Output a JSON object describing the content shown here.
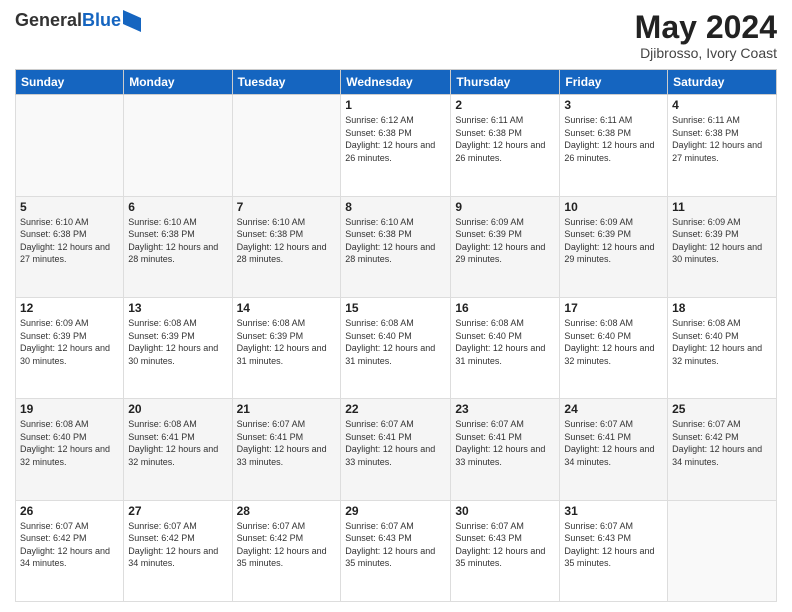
{
  "header": {
    "logo_line1": "General",
    "logo_line2": "Blue",
    "title": "May 2024",
    "location": "Djibrosso, Ivory Coast"
  },
  "weekdays": [
    "Sunday",
    "Monday",
    "Tuesday",
    "Wednesday",
    "Thursday",
    "Friday",
    "Saturday"
  ],
  "weeks": [
    [
      {
        "day": "",
        "sunrise": "",
        "sunset": "",
        "daylight": ""
      },
      {
        "day": "",
        "sunrise": "",
        "sunset": "",
        "daylight": ""
      },
      {
        "day": "",
        "sunrise": "",
        "sunset": "",
        "daylight": ""
      },
      {
        "day": "1",
        "sunrise": "Sunrise: 6:12 AM",
        "sunset": "Sunset: 6:38 PM",
        "daylight": "Daylight: 12 hours and 26 minutes."
      },
      {
        "day": "2",
        "sunrise": "Sunrise: 6:11 AM",
        "sunset": "Sunset: 6:38 PM",
        "daylight": "Daylight: 12 hours and 26 minutes."
      },
      {
        "day": "3",
        "sunrise": "Sunrise: 6:11 AM",
        "sunset": "Sunset: 6:38 PM",
        "daylight": "Daylight: 12 hours and 26 minutes."
      },
      {
        "day": "4",
        "sunrise": "Sunrise: 6:11 AM",
        "sunset": "Sunset: 6:38 PM",
        "daylight": "Daylight: 12 hours and 27 minutes."
      }
    ],
    [
      {
        "day": "5",
        "sunrise": "Sunrise: 6:10 AM",
        "sunset": "Sunset: 6:38 PM",
        "daylight": "Daylight: 12 hours and 27 minutes."
      },
      {
        "day": "6",
        "sunrise": "Sunrise: 6:10 AM",
        "sunset": "Sunset: 6:38 PM",
        "daylight": "Daylight: 12 hours and 28 minutes."
      },
      {
        "day": "7",
        "sunrise": "Sunrise: 6:10 AM",
        "sunset": "Sunset: 6:38 PM",
        "daylight": "Daylight: 12 hours and 28 minutes."
      },
      {
        "day": "8",
        "sunrise": "Sunrise: 6:10 AM",
        "sunset": "Sunset: 6:38 PM",
        "daylight": "Daylight: 12 hours and 28 minutes."
      },
      {
        "day": "9",
        "sunrise": "Sunrise: 6:09 AM",
        "sunset": "Sunset: 6:39 PM",
        "daylight": "Daylight: 12 hours and 29 minutes."
      },
      {
        "day": "10",
        "sunrise": "Sunrise: 6:09 AM",
        "sunset": "Sunset: 6:39 PM",
        "daylight": "Daylight: 12 hours and 29 minutes."
      },
      {
        "day": "11",
        "sunrise": "Sunrise: 6:09 AM",
        "sunset": "Sunset: 6:39 PM",
        "daylight": "Daylight: 12 hours and 30 minutes."
      }
    ],
    [
      {
        "day": "12",
        "sunrise": "Sunrise: 6:09 AM",
        "sunset": "Sunset: 6:39 PM",
        "daylight": "Daylight: 12 hours and 30 minutes."
      },
      {
        "day": "13",
        "sunrise": "Sunrise: 6:08 AM",
        "sunset": "Sunset: 6:39 PM",
        "daylight": "Daylight: 12 hours and 30 minutes."
      },
      {
        "day": "14",
        "sunrise": "Sunrise: 6:08 AM",
        "sunset": "Sunset: 6:39 PM",
        "daylight": "Daylight: 12 hours and 31 minutes."
      },
      {
        "day": "15",
        "sunrise": "Sunrise: 6:08 AM",
        "sunset": "Sunset: 6:40 PM",
        "daylight": "Daylight: 12 hours and 31 minutes."
      },
      {
        "day": "16",
        "sunrise": "Sunrise: 6:08 AM",
        "sunset": "Sunset: 6:40 PM",
        "daylight": "Daylight: 12 hours and 31 minutes."
      },
      {
        "day": "17",
        "sunrise": "Sunrise: 6:08 AM",
        "sunset": "Sunset: 6:40 PM",
        "daylight": "Daylight: 12 hours and 32 minutes."
      },
      {
        "day": "18",
        "sunrise": "Sunrise: 6:08 AM",
        "sunset": "Sunset: 6:40 PM",
        "daylight": "Daylight: 12 hours and 32 minutes."
      }
    ],
    [
      {
        "day": "19",
        "sunrise": "Sunrise: 6:08 AM",
        "sunset": "Sunset: 6:40 PM",
        "daylight": "Daylight: 12 hours and 32 minutes."
      },
      {
        "day": "20",
        "sunrise": "Sunrise: 6:08 AM",
        "sunset": "Sunset: 6:41 PM",
        "daylight": "Daylight: 12 hours and 32 minutes."
      },
      {
        "day": "21",
        "sunrise": "Sunrise: 6:07 AM",
        "sunset": "Sunset: 6:41 PM",
        "daylight": "Daylight: 12 hours and 33 minutes."
      },
      {
        "day": "22",
        "sunrise": "Sunrise: 6:07 AM",
        "sunset": "Sunset: 6:41 PM",
        "daylight": "Daylight: 12 hours and 33 minutes."
      },
      {
        "day": "23",
        "sunrise": "Sunrise: 6:07 AM",
        "sunset": "Sunset: 6:41 PM",
        "daylight": "Daylight: 12 hours and 33 minutes."
      },
      {
        "day": "24",
        "sunrise": "Sunrise: 6:07 AM",
        "sunset": "Sunset: 6:41 PM",
        "daylight": "Daylight: 12 hours and 34 minutes."
      },
      {
        "day": "25",
        "sunrise": "Sunrise: 6:07 AM",
        "sunset": "Sunset: 6:42 PM",
        "daylight": "Daylight: 12 hours and 34 minutes."
      }
    ],
    [
      {
        "day": "26",
        "sunrise": "Sunrise: 6:07 AM",
        "sunset": "Sunset: 6:42 PM",
        "daylight": "Daylight: 12 hours and 34 minutes."
      },
      {
        "day": "27",
        "sunrise": "Sunrise: 6:07 AM",
        "sunset": "Sunset: 6:42 PM",
        "daylight": "Daylight: 12 hours and 34 minutes."
      },
      {
        "day": "28",
        "sunrise": "Sunrise: 6:07 AM",
        "sunset": "Sunset: 6:42 PM",
        "daylight": "Daylight: 12 hours and 35 minutes."
      },
      {
        "day": "29",
        "sunrise": "Sunrise: 6:07 AM",
        "sunset": "Sunset: 6:43 PM",
        "daylight": "Daylight: 12 hours and 35 minutes."
      },
      {
        "day": "30",
        "sunrise": "Sunrise: 6:07 AM",
        "sunset": "Sunset: 6:43 PM",
        "daylight": "Daylight: 12 hours and 35 minutes."
      },
      {
        "day": "31",
        "sunrise": "Sunrise: 6:07 AM",
        "sunset": "Sunset: 6:43 PM",
        "daylight": "Daylight: 12 hours and 35 minutes."
      },
      {
        "day": "",
        "sunrise": "",
        "sunset": "",
        "daylight": ""
      }
    ]
  ]
}
